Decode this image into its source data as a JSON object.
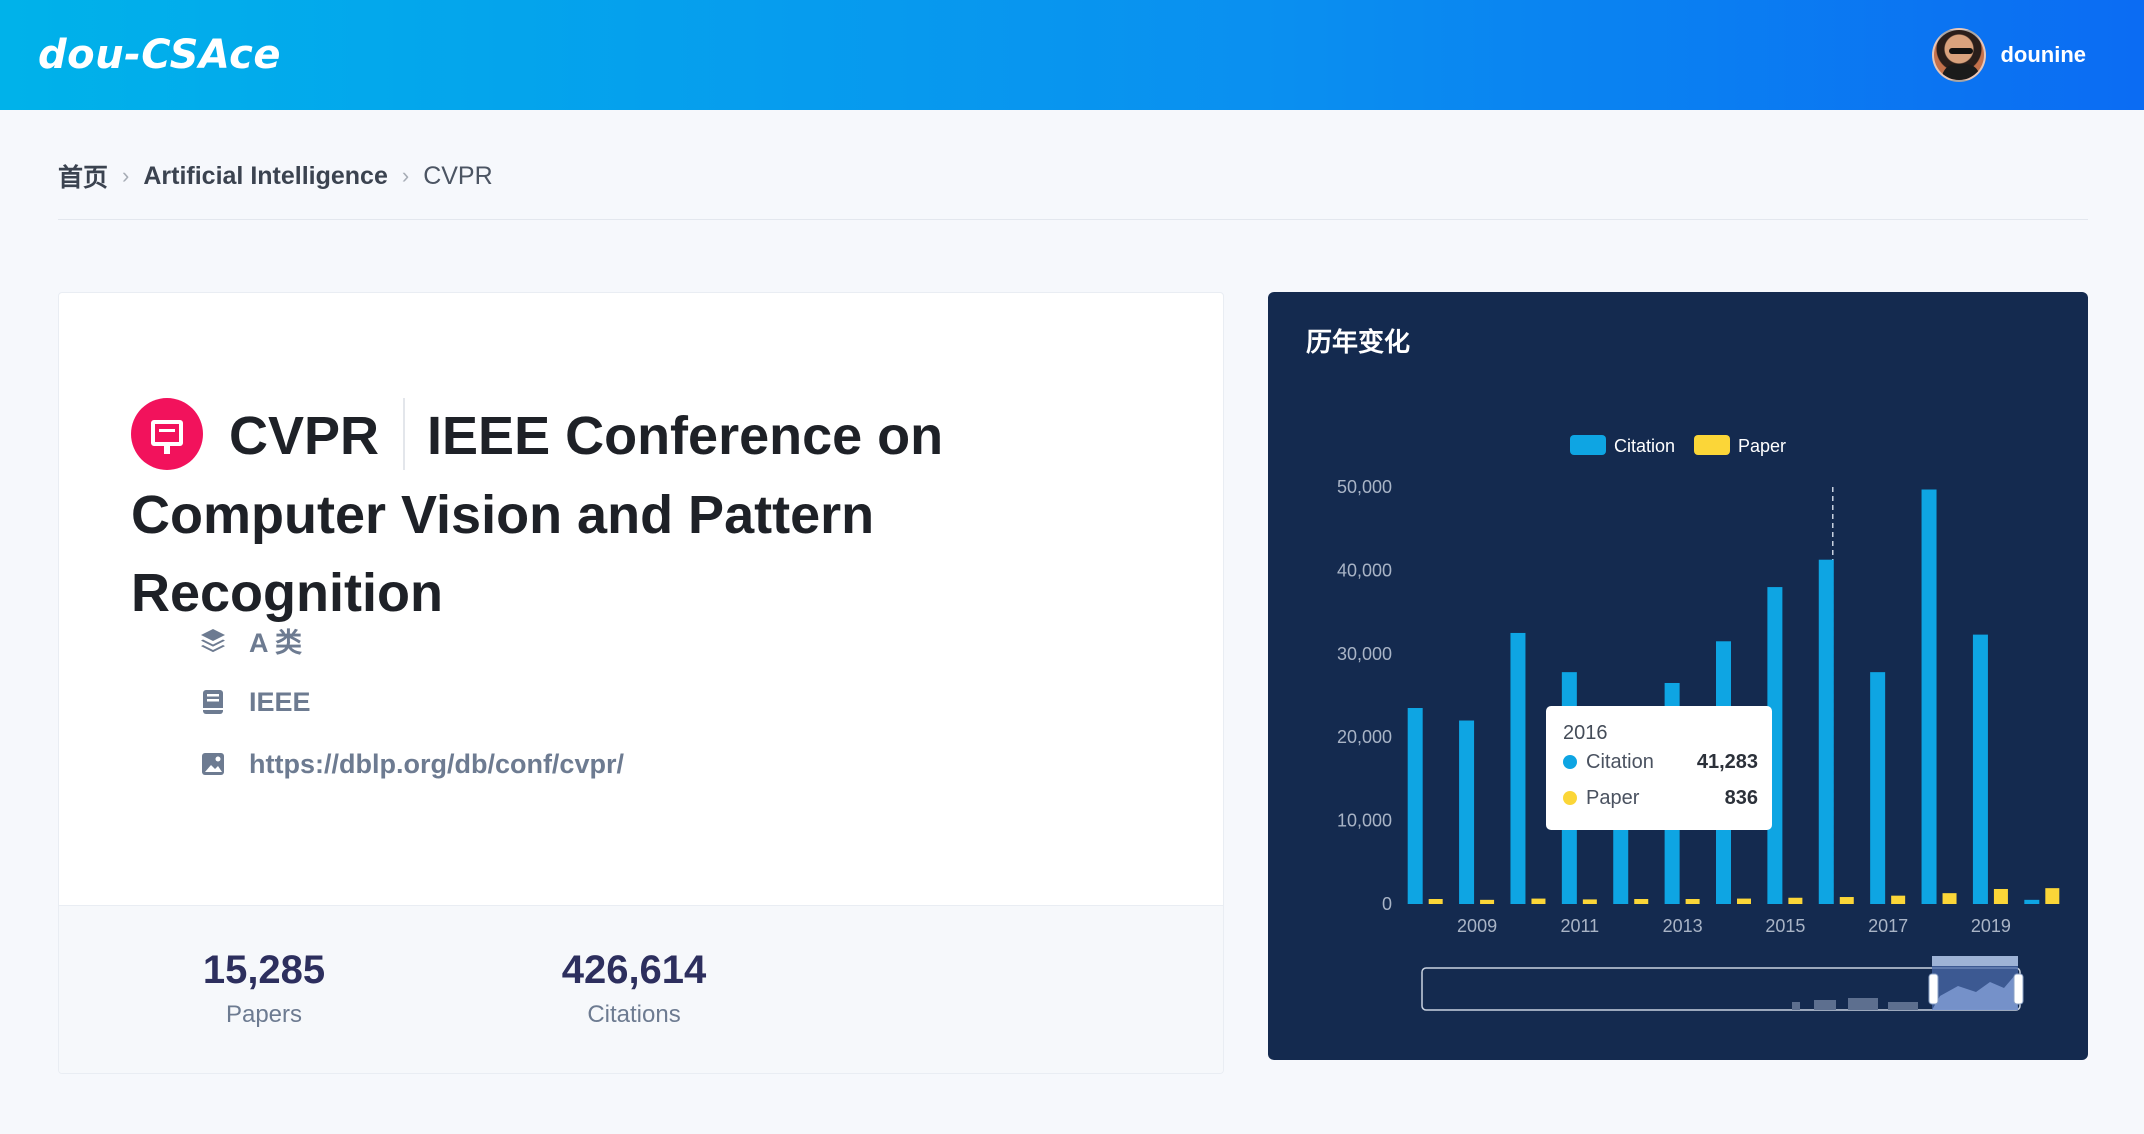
{
  "header": {
    "logo": "dou-CSAce",
    "username": "dounine"
  },
  "breadcrumb": {
    "home": "首页",
    "category": "Artificial Intelligence",
    "current": "CVPR"
  },
  "conference": {
    "abbr": "CVPR",
    "full_name": "IEEE Conference on Computer Vision and Pattern Recognition",
    "rank": "A 类",
    "publisher": "IEEE",
    "url": "https://dblp.org/db/conf/cvpr/"
  },
  "stats": {
    "papers_value": "15,285",
    "papers_label": "Papers",
    "citations_value": "426,614",
    "citations_label": "Citations"
  },
  "chart_panel": {
    "title": "历年变化"
  },
  "tooltip": {
    "year": "2016",
    "rows": [
      {
        "name": "Citation",
        "value": "41,283"
      },
      {
        "name": "Paper",
        "value": "836"
      }
    ]
  },
  "colors": {
    "citation": "#0ea5e3",
    "paper": "#fbd638",
    "panel_bg": "#142a4f",
    "header_start": "#00b2ea",
    "header_end": "#0b6cf3"
  },
  "chart_data": {
    "type": "bar",
    "categories": [
      "2008",
      "2009",
      "2010",
      "2011",
      "2012",
      "2013",
      "2014",
      "2015",
      "2016",
      "2017",
      "2018",
      "2019",
      "2020"
    ],
    "x_tick_labels": [
      "2009",
      "2011",
      "2013",
      "2015",
      "2017",
      "2019"
    ],
    "series": [
      {
        "name": "Citation",
        "values": [
          23500,
          22000,
          32500,
          27800,
          16000,
          26500,
          31500,
          38000,
          41283,
          27800,
          49700,
          32300,
          500
        ]
      },
      {
        "name": "Paper",
        "values": [
          600,
          500,
          650,
          550,
          600,
          600,
          650,
          750,
          836,
          1000,
          1300,
          1800,
          1900
        ]
      }
    ],
    "y_ticks": [
      "0",
      "10,000",
      "20,000",
      "30,000",
      "40,000",
      "50,000"
    ],
    "ylim": [
      0,
      50000
    ],
    "legend_position": "top-center",
    "highlight_category": "2016",
    "data_zoom": true
  }
}
